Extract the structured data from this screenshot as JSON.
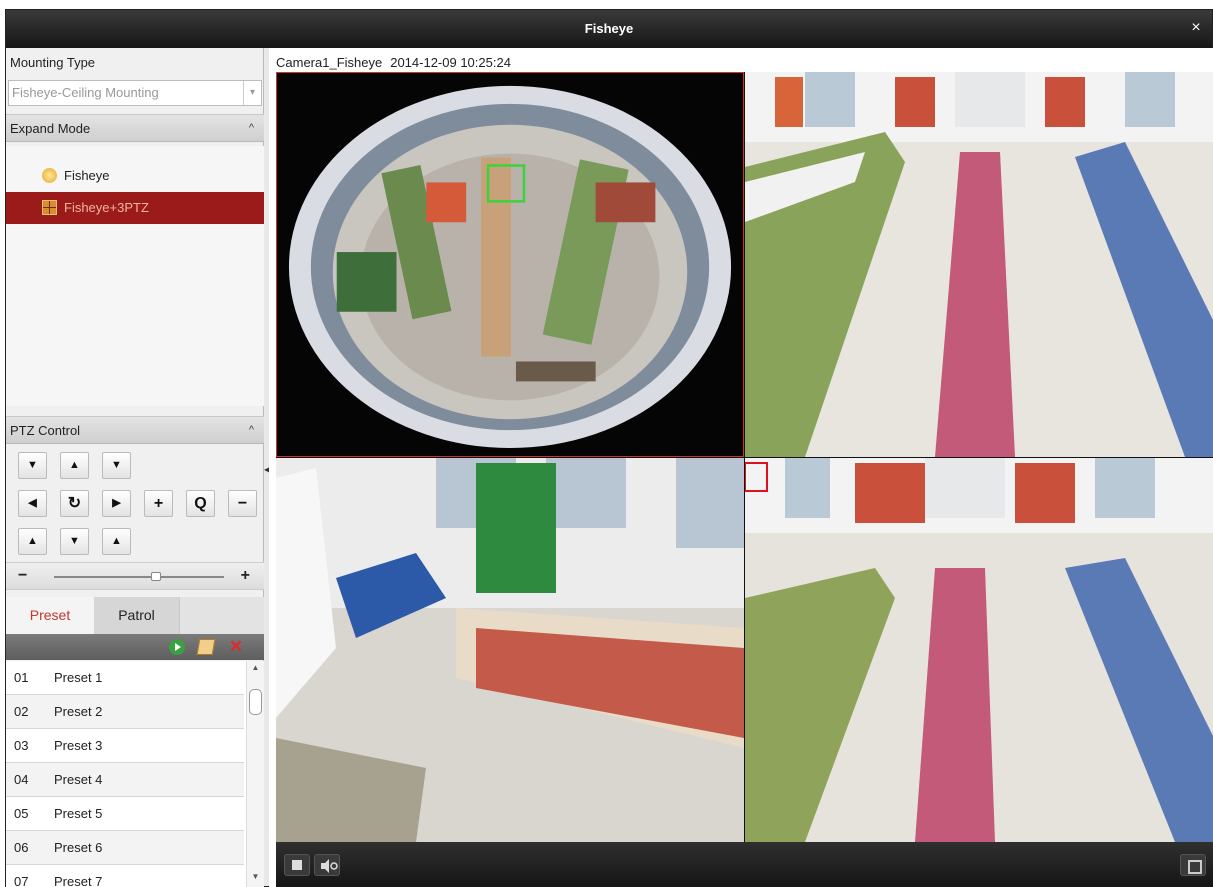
{
  "window": {
    "title": "Fisheye",
    "close_symbol": "×"
  },
  "left_panel": {
    "mounting_type_label": "Mounting Type",
    "mounting_type_value": "Fisheye-Ceiling Mounting",
    "expand_mode_label": "Expand Mode",
    "modes": [
      {
        "label": "Fisheye",
        "icon": "fisheye-icon",
        "active": false
      },
      {
        "label": "Fisheye+3PTZ",
        "icon": "grid-icon",
        "active": true
      }
    ],
    "ptz_label": "PTZ Control",
    "ptz_symbols": {
      "up_left": "▼",
      "up": "▲",
      "up_right": "▼",
      "left": "◀",
      "auto": "↻",
      "right": "▶",
      "down_left": "▲",
      "down": "▼",
      "down_right": "▲",
      "zoom_in": "+",
      "zoom_search": "Q",
      "zoom_out": "−",
      "speed_minus": "−",
      "speed_plus": "+"
    },
    "speed_level": 0.6,
    "tabs": [
      {
        "label": "Preset",
        "active": true
      },
      {
        "label": "Patrol",
        "active": false
      }
    ],
    "presets": [
      {
        "num": "01",
        "name": "Preset 1"
      },
      {
        "num": "02",
        "name": "Preset 2"
      },
      {
        "num": "03",
        "name": "Preset 3"
      },
      {
        "num": "04",
        "name": "Preset 4"
      },
      {
        "num": "05",
        "name": "Preset 5"
      },
      {
        "num": "06",
        "name": "Preset 6"
      },
      {
        "num": "07",
        "name": "Preset 7"
      }
    ]
  },
  "video": {
    "camera_name": "Camera1_Fisheye",
    "timestamp": "2014-12-09 10:25:24",
    "active_pane_border_color": "#cc3333"
  },
  "colors": {
    "accent": "#9b1a1a",
    "tab_active_text": "#c4372c"
  }
}
